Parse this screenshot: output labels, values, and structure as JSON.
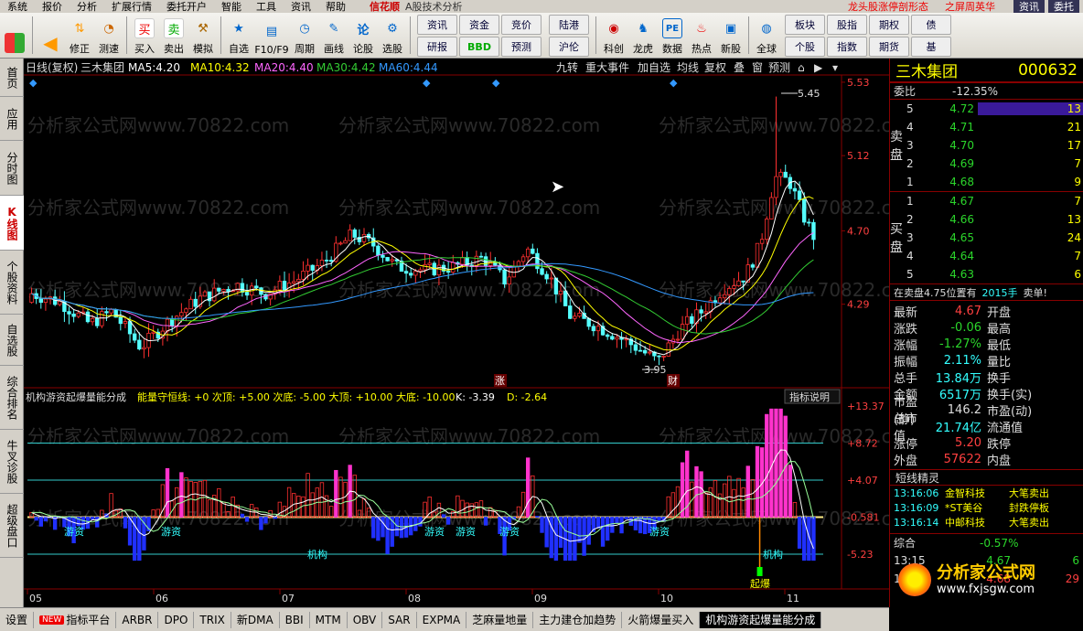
{
  "menubar": {
    "items": [
      "系统",
      "报价",
      "分析",
      "扩展行情",
      "委托开户",
      "智能",
      "工具",
      "资讯",
      "帮助"
    ],
    "brand": "信花顺",
    "sub": "A股技术分析",
    "promo": "龙头股涨停剖形态",
    "promo2": "之屏周英华",
    "right_btn": "资讯",
    "right_btn2": "委托"
  },
  "toolbar": {
    "buttons": [
      {
        "label": "",
        "icon": "grid-icon"
      },
      {
        "label": "",
        "icon": "back-arrow-icon"
      },
      {
        "label": "修正",
        "icon": "updown-icon"
      },
      {
        "label": "测速",
        "icon": "speed-icon"
      },
      {
        "label": "买入",
        "icon": "buy-icon",
        "glyph": "买"
      },
      {
        "label": "卖出",
        "icon": "sell-icon",
        "glyph": "卖"
      },
      {
        "label": "模拟",
        "icon": "hammer-icon"
      },
      {
        "label": "自选",
        "icon": "star-icon"
      },
      {
        "label": "F10/F9",
        "icon": "f10-icon"
      },
      {
        "label": "周期",
        "icon": "clock-icon"
      },
      {
        "label": "画线",
        "icon": "pen-icon"
      },
      {
        "label": "论股",
        "icon": "lun-icon",
        "glyph": "论"
      },
      {
        "label": "选股",
        "icon": "select-icon"
      }
    ],
    "grid1": [
      "资讯",
      "资金",
      "竞价",
      "研报",
      "BBD",
      "预测"
    ],
    "grid2": [
      "陆港",
      "沪伦"
    ],
    "buttons2": [
      {
        "label": "科创",
        "icon": "kc-icon"
      },
      {
        "label": "龙虎",
        "icon": "dragon-icon"
      },
      {
        "label": "数据",
        "icon": "pe-icon",
        "glyph": "PE"
      },
      {
        "label": "热点",
        "icon": "hot-icon"
      },
      {
        "label": "新股",
        "icon": "new-icon"
      },
      {
        "label": "全球",
        "icon": "globe-icon"
      }
    ],
    "grid3": [
      "板块",
      "股指",
      "期权",
      "个股",
      "指数",
      "期货",
      "债",
      "基"
    ]
  },
  "lefttabs": [
    "首页",
    "应用",
    "分时图",
    "K线图",
    "个股资料",
    "自选股",
    "综合排名",
    "牛叉诊股",
    "超级盘口"
  ],
  "chart": {
    "period": "日线(复权)",
    "name": "三木集团",
    "ma": [
      {
        "label": "MA5:",
        "value": "4.20",
        "color": "#ffffff"
      },
      {
        "label": "MA10:",
        "value": "4.32",
        "color": "#ffff00"
      },
      {
        "label": "MA20:",
        "value": "4.40",
        "color": "#ff66ff"
      },
      {
        "label": "MA30:",
        "value": "4.42",
        "color": "#33cc33"
      },
      {
        "label": "MA60:",
        "value": "4.44",
        "color": "#3399ff"
      }
    ],
    "top_buttons": [
      "九转",
      "重大事件",
      "加自选",
      "均线",
      "复权",
      "叠",
      "窗",
      "预测"
    ],
    "price_ticks": [
      "5.53",
      "5.12",
      "4.70",
      "4.29"
    ],
    "high_label": "5.45",
    "low_label": "3.95",
    "marker_zhang": "涨",
    "marker_cai": "财",
    "indicator_name": "机构游资起爆量能分成",
    "indicator_line": "能量守恒线: +0  次顶: +5.00  次底: -5.00  大顶: +10.00  大底: -10.00",
    "indicator_k": "K: -3.39",
    "indicator_d": "D: -2.64",
    "indicator_help": "指标说明",
    "ind_ticks": [
      "+13.37",
      "+8.72",
      "+4.07",
      "-0.581",
      "-5.23"
    ],
    "labels_youzi": "游资",
    "labels_jigou": "机构",
    "label_qibao": "起爆",
    "months": [
      "05",
      "06",
      "07",
      "08",
      "09",
      "10",
      "11"
    ],
    "watermark": "分析家公式网www.70822.com"
  },
  "chart_data": {
    "type": "candlestick",
    "title": "",
    "y_range": [
      3.9,
      5.55
    ],
    "price_axis_ticks": [
      5.53,
      5.12,
      4.7,
      4.29
    ],
    "high": 5.45,
    "low": 3.95,
    "indicator_range": [
      -5.23,
      13.37
    ],
    "indicator_levels": [
      13.37,
      8.72,
      4.07,
      -0.581,
      -5.23
    ],
    "k_last": -3.39,
    "d_last": -2.64
  },
  "right": {
    "name": "三木集团",
    "code": "000632",
    "weibi_label": "委比",
    "weibi": "-12.35%",
    "sell_label": "卖盘",
    "buy_label": "买盘",
    "sells": [
      {
        "lv": "5",
        "price": "4.72",
        "vol": "13"
      },
      {
        "lv": "4",
        "price": "4.71",
        "vol": "21"
      },
      {
        "lv": "3",
        "price": "4.70",
        "vol": "17"
      },
      {
        "lv": "2",
        "price": "4.69",
        "vol": "7"
      },
      {
        "lv": "1",
        "price": "4.68",
        "vol": "9"
      }
    ],
    "buys": [
      {
        "lv": "1",
        "price": "4.67",
        "vol": "7"
      },
      {
        "lv": "2",
        "price": "4.66",
        "vol": "13"
      },
      {
        "lv": "3",
        "price": "4.65",
        "vol": "24"
      },
      {
        "lv": "4",
        "price": "4.64",
        "vol": "7"
      },
      {
        "lv": "5",
        "price": "4.63",
        "vol": "6"
      }
    ],
    "notice": "在卖盘4.75位置有",
    "notice_vol": "2015手",
    "notice_act": "卖单!",
    "quote": [
      {
        "a": "最新",
        "b": "4.67",
        "c": "开盘",
        "cls": "red"
      },
      {
        "a": "涨跌",
        "b": "-0.06",
        "c": "最高",
        "cls": "green"
      },
      {
        "a": "涨幅",
        "b": "-1.27%",
        "c": "最低",
        "cls": "green"
      },
      {
        "a": "振幅",
        "b": "2.11%",
        "c": "量比",
        "cls": "cyan"
      },
      {
        "a": "总手",
        "b": "13.84万",
        "c": "换手",
        "cls": "cyan"
      },
      {
        "a": "金额",
        "b": "6517万",
        "c": "换手(实)",
        "cls": "cyan"
      },
      {
        "a": "市盈(静)",
        "b": "146.2",
        "c": "市盈(动)",
        "cls": "white"
      },
      {
        "a": "总市值",
        "b": "21.74亿",
        "c": "流通值",
        "cls": "cyan"
      },
      {
        "a": "涨停",
        "b": "5.20",
        "c": "跌停",
        "cls": "red"
      },
      {
        "a": "外盘",
        "b": "57622",
        "c": "内盘",
        "cls": "red"
      }
    ],
    "spirit_title": "短线精灵",
    "spirits": [
      {
        "t": "13:16:06",
        "s": "金智科技",
        "e": "大笔卖出"
      },
      {
        "t": "13:16:09",
        "s": "*ST美谷",
        "e": "封跌停板"
      },
      {
        "t": "13:16:14",
        "s": "中邮科技",
        "e": "大笔卖出"
      }
    ],
    "composite_label": "综合",
    "composite_value": "-0.57%",
    "ticks": [
      {
        "t": "13:15",
        "p": "4.67",
        "v": "6"
      },
      {
        "t": "13:15",
        "p": "4.68",
        "v": "29"
      }
    ],
    "logo_text": "分析家公式网",
    "logo_url": "www.fxjsgw.com"
  },
  "bottombar": {
    "tabs": [
      "设置",
      "指标平台",
      "ARBR",
      "DPO",
      "TRIX",
      "新DMA",
      "BBI",
      "MTM",
      "OBV",
      "SAR",
      "EXPMA",
      "芝麻量地量",
      "主力建仓加趋势",
      "火箭爆量买入",
      "机构游资起爆量能分成"
    ],
    "new_badge": "NEW"
  }
}
